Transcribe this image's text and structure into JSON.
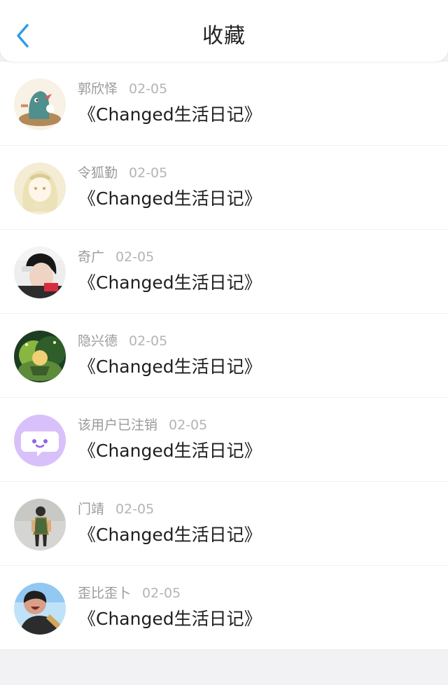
{
  "header": {
    "title": "收藏",
    "back_icon": "chevron-left-icon",
    "accent_color": "#2f9be9"
  },
  "favorites": [
    {
      "user": "郭欣怿",
      "date": "02-05",
      "content": "《Changed生活日记》",
      "avatar": "cartoon-bird-avatar"
    },
    {
      "user": "令狐勤",
      "date": "02-05",
      "content": "《Changed生活日记》",
      "avatar": "anime-girl-avatar"
    },
    {
      "user": "奇广",
      "date": "02-05",
      "content": "《Changed生活日记》",
      "avatar": "boy-photo-avatar"
    },
    {
      "user": "隐兴德",
      "date": "02-05",
      "content": "《Changed生活日记》",
      "avatar": "anime-forest-avatar"
    },
    {
      "user": "该用户已注销",
      "date": "02-05",
      "content": "《Changed生活日记》",
      "avatar": "deleted-user-chat-avatar"
    },
    {
      "user": "门靖",
      "date": "02-05",
      "content": "《Changed生活日记》",
      "avatar": "child-photo-avatar"
    },
    {
      "user": "歪比歪卜",
      "date": "02-05",
      "content": "《Changed生活日记》",
      "avatar": "man-shouting-avatar"
    }
  ]
}
